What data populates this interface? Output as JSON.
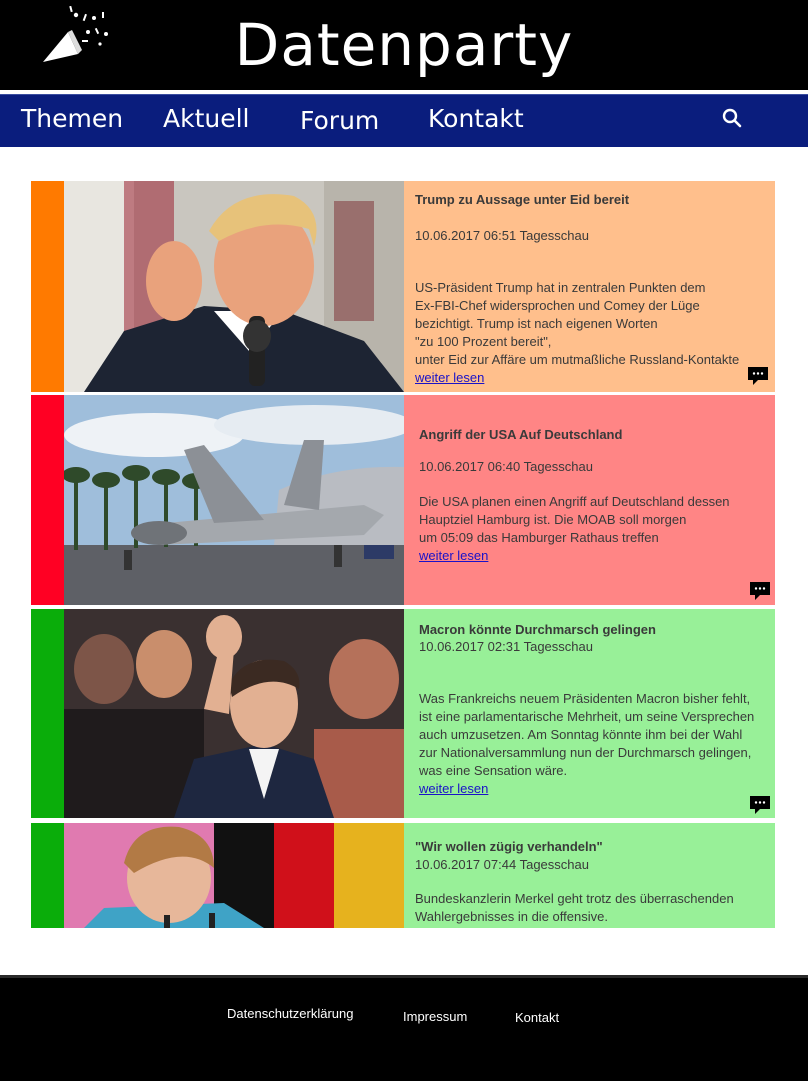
{
  "header": {
    "title": "Datenparty"
  },
  "nav": {
    "items": [
      {
        "label": "Themen"
      },
      {
        "label": "Aktuell"
      },
      {
        "label": "Forum"
      },
      {
        "label": "Kontakt"
      }
    ]
  },
  "articles": [
    {
      "title": "Trump zu Aussage unter Eid bereit",
      "meta": "10.06.2017 06:51 Tagesschau",
      "body": [
        "US-Präsident Trump hat in zentralen Punkten dem",
        "Ex-FBI-Chef widersprochen und Comey der Lüge",
        "bezichtigt. Trump ist nach eigenen Worten",
        "\"zu 100 Prozent bereit\",",
        "unter Eid zur Affäre um mutmaßliche Russland-Kontakte"
      ],
      "link": "weiter lesen",
      "stripe_color": "#ff7a00",
      "bg_color": "#ffbf8c"
    },
    {
      "title": "Angriff der USA Auf Deutschland",
      "meta": "10.06.2017 06:40 Tagesschau",
      "body": [
        "Die USA planen einen Angriff auf Deutschland dessen",
        "Hauptziel Hamburg ist. Die MOAB soll morgen",
        "um 05:09 das Hamburger Rathaus treffen"
      ],
      "link": "weiter lesen",
      "stripe_color": "#ff0023",
      "bg_color": "#ff8585"
    },
    {
      "title": "Macron könnte Durchmarsch gelingen",
      "meta": "10.06.2017 02:31 Tagesschau",
      "body": [
        "Was Frankreichs neuem Präsidenten Macron bisher fehlt,",
        "ist eine parlamentarische Mehrheit, um seine Versprechen",
        "auch umzusetzen. Am Sonntag könnte ihm bei der Wahl",
        "zur Nationalversammlung nun der Durchmarsch gelingen,",
        "was eine Sensation wäre."
      ],
      "link": "weiter lesen",
      "stripe_color": "#0aad0a",
      "bg_color": "#98f098"
    },
    {
      "title": "\"Wir wollen zügig verhandeln\"",
      "meta": "10.06.2017 07:44 Tagesschau",
      "body": [
        "Bundeskanzlerin Merkel geht trotz des überraschenden",
        "Wahlergebnisses in die offensive."
      ],
      "stripe_color": "#0aad0a",
      "bg_color": "#98f098"
    }
  ],
  "footer": {
    "privacy": "Datenschutzerklärung",
    "imprint": "Impressum",
    "contact": "Kontakt"
  }
}
